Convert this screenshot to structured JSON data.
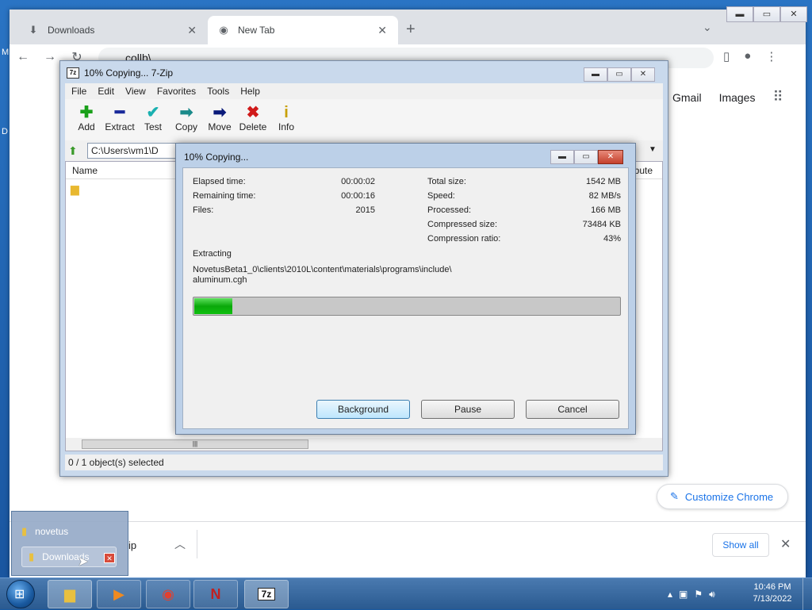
{
  "chrome": {
    "tabs": [
      {
        "icon": "download-icon",
        "label": "Downloads"
      },
      {
        "icon": "chrome-icon",
        "label": "New Tab"
      }
    ],
    "omnibox_value": "collb\\",
    "links": [
      "Gmail",
      "Images"
    ],
    "customize_label": "Customize Chrome",
    "download_bar": {
      "file": "ip",
      "show_all": "Show all"
    }
  },
  "zip": {
    "title": "10% Copying... 7-Zip",
    "menu": [
      "File",
      "Edit",
      "View",
      "Favorites",
      "Tools",
      "Help"
    ],
    "toolbar": [
      {
        "label": "Add",
        "glyph": "+",
        "color": "#1aa01a"
      },
      {
        "label": "Extract",
        "glyph": "━",
        "color": "#1a2a9a"
      },
      {
        "label": "Test",
        "glyph": "✔",
        "color": "#1ab0b0"
      },
      {
        "label": "Copy",
        "glyph": "➡",
        "color": "#1a8a8a"
      },
      {
        "label": "Move",
        "glyph": "➡",
        "color": "#0a1a7a"
      },
      {
        "label": "Delete",
        "glyph": "✖",
        "color": "#d01a1a"
      },
      {
        "label": "Info",
        "glyph": "i",
        "color": "#c8a000"
      }
    ],
    "path": "C:\\Users\\vm1\\D",
    "col_name": "Name",
    "col_attr": "ribute",
    "status": "0 / 1 object(s) selected"
  },
  "dialog": {
    "title": "10% Copying...",
    "left_stats": [
      {
        "label": "Elapsed time:",
        "value": "00:00:02"
      },
      {
        "label": "Remaining time:",
        "value": "00:00:16"
      },
      {
        "label": "Files:",
        "value": "2015"
      }
    ],
    "right_stats": [
      {
        "label": "Total size:",
        "value": "1542 MB"
      },
      {
        "label": "Speed:",
        "value": "82 MB/s"
      },
      {
        "label": "Processed:",
        "value": "166 MB"
      },
      {
        "label": "Compressed size:",
        "value": "73484 KB"
      },
      {
        "label": "Compression ratio:",
        "value": "43%"
      }
    ],
    "action": "Extracting",
    "file_line1": "NovetusBeta1_0\\clients\\2010L\\content\\materials\\programs\\include\\",
    "file_line2": "aluminum.cgh",
    "progress": 0.09,
    "buttons": {
      "background": "Background",
      "pause": "Pause",
      "cancel": "Cancel"
    }
  },
  "jumplist": {
    "item1": "novetus",
    "item2": "Downloads"
  },
  "taskbar": {
    "time": "10:46 PM",
    "date": "7/13/2022",
    "zip_label": "7z"
  }
}
